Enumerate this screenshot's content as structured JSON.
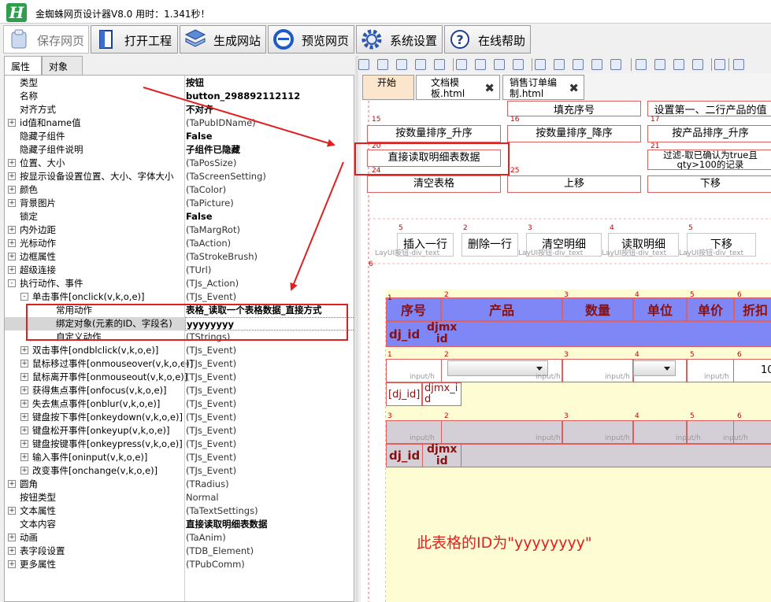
{
  "app": {
    "title": "金蜘蛛网页设计器V8.0 用时：1.341秒！",
    "logo_letter": "H"
  },
  "toolbar": [
    {
      "label": "保存网页",
      "icon": "save-page-icon",
      "pressed": true
    },
    {
      "label": "打开工程",
      "icon": "open-project-icon",
      "pressed": false
    },
    {
      "label": "生成网站",
      "icon": "generate-site-icon",
      "pressed": false
    },
    {
      "label": "预览网页",
      "icon": "preview-ie-icon",
      "pressed": false
    },
    {
      "label": "系统设置",
      "icon": "settings-gear-icon",
      "pressed": false
    },
    {
      "label": "在线帮助",
      "icon": "help-icon",
      "pressed": false
    }
  ],
  "panel_tabs": [
    "属性",
    "对象"
  ],
  "props": [
    {
      "name": "类型",
      "value": "按钮",
      "bold": true,
      "level": 0,
      "exp": ""
    },
    {
      "name": "名称",
      "value": "button_298892112112",
      "bold": true,
      "level": 0,
      "exp": ""
    },
    {
      "name": "对齐方式",
      "value": "不对齐",
      "bold": true,
      "level": 0,
      "exp": ""
    },
    {
      "name": "id值和name值",
      "value": "(TaPubIDName)",
      "bold": false,
      "level": 0,
      "exp": "+"
    },
    {
      "name": "隐藏子组件",
      "value": "False",
      "bold": true,
      "level": 0,
      "exp": ""
    },
    {
      "name": "隐藏子组件说明",
      "value": "子组件已隐藏",
      "bold": true,
      "level": 0,
      "exp": ""
    },
    {
      "name": "位置、大小",
      "value": "(TaPosSize)",
      "bold": false,
      "level": 0,
      "exp": "+"
    },
    {
      "name": "按显示设备设置位置、大小、字体大小",
      "value": "(TaScreenSetting)",
      "bold": false,
      "level": 0,
      "exp": "+"
    },
    {
      "name": "颜色",
      "value": "(TaColor)",
      "bold": false,
      "level": 0,
      "exp": "+"
    },
    {
      "name": "背景图片",
      "value": "(TaPicture)",
      "bold": false,
      "level": 0,
      "exp": "+"
    },
    {
      "name": "锁定",
      "value": "False",
      "bold": true,
      "level": 0,
      "exp": ""
    },
    {
      "name": "内外边距",
      "value": "(TaMargRot)",
      "bold": false,
      "level": 0,
      "exp": "+"
    },
    {
      "name": "光标动作",
      "value": "(TaAction)",
      "bold": false,
      "level": 0,
      "exp": "+"
    },
    {
      "name": "边框属性",
      "value": "(TaStrokeBrush)",
      "bold": false,
      "level": 0,
      "exp": "+"
    },
    {
      "name": "超级连接",
      "value": "(TUrl)",
      "bold": false,
      "level": 0,
      "exp": "+"
    },
    {
      "name": "执行动作、事件",
      "value": "(TJs_Action)",
      "bold": false,
      "level": 0,
      "exp": "-"
    },
    {
      "name": "单击事件[onclick(v,k,o,e)]",
      "value": "(TJs_Event)",
      "bold": false,
      "level": 1,
      "exp": "-"
    },
    {
      "name": "常用动作",
      "value": "表格_读取一个表格数据_直接方式",
      "bold": true,
      "level": 2,
      "exp": ""
    },
    {
      "name": "绑定对象(元素的ID、字段名)",
      "value": "yyyyyyyy",
      "bold": true,
      "level": 2,
      "exp": "",
      "selected": true
    },
    {
      "name": "自定义动作",
      "value": "(TStrings)",
      "bold": false,
      "level": 2,
      "exp": ""
    },
    {
      "name": "双击事件[ondblclick(v,k,o,e)]",
      "value": "(TJs_Event)",
      "bold": false,
      "level": 1,
      "exp": "+"
    },
    {
      "name": "鼠标移过事件[onmouseover(v,k,o,e)]",
      "value": "(TJs_Event)",
      "bold": false,
      "level": 1,
      "exp": "+"
    },
    {
      "name": "鼠标离开事件[onmouseout(v,k,o,e)]",
      "value": "(TJs_Event)",
      "bold": false,
      "level": 1,
      "exp": "+"
    },
    {
      "name": "获得焦点事件[onfocus(v,k,o,e)]",
      "value": "(TJs_Event)",
      "bold": false,
      "level": 1,
      "exp": "+"
    },
    {
      "name": "失去焦点事件[onblur(v,k,o,e)]",
      "value": "(TJs_Event)",
      "bold": false,
      "level": 1,
      "exp": "+"
    },
    {
      "name": "键盘按下事件[onkeydown(v,k,o,e)]",
      "value": "(TJs_Event)",
      "bold": false,
      "level": 1,
      "exp": "+"
    },
    {
      "name": "键盘松开事件[onkeyup(v,k,o,e)]",
      "value": "(TJs_Event)",
      "bold": false,
      "level": 1,
      "exp": "+"
    },
    {
      "name": "键盘按键事件[onkeypress(v,k,o,e)]",
      "value": "(TJs_Event)",
      "bold": false,
      "level": 1,
      "exp": "+"
    },
    {
      "name": "输入事件[oninput(v,k,o,e)]",
      "value": "(TJs_Event)",
      "bold": false,
      "level": 1,
      "exp": "+"
    },
    {
      "name": "改变事件[onchange(v,k,o,e)]",
      "value": "(TJs_Event)",
      "bold": false,
      "level": 1,
      "exp": "+"
    },
    {
      "name": "圆角",
      "value": "(TRadius)",
      "bold": false,
      "level": 0,
      "exp": "+"
    },
    {
      "name": "按钮类型",
      "value": "Normal",
      "bold": false,
      "level": 0,
      "exp": ""
    },
    {
      "name": "文本属性",
      "value": "(TaTextSettings)",
      "bold": false,
      "level": 0,
      "exp": "+"
    },
    {
      "name": "文本内容",
      "value": "直接读取明细表数据",
      "bold": true,
      "level": 0,
      "exp": ""
    },
    {
      "name": "动画",
      "value": "(TaAnim)",
      "bold": false,
      "level": 0,
      "exp": "+"
    },
    {
      "name": "表字段设置",
      "value": "(TDB_Element)",
      "bold": false,
      "level": 0,
      "exp": "+"
    },
    {
      "name": "更多属性",
      "value": "(TPubComm)",
      "bold": false,
      "level": 0,
      "exp": "+"
    }
  ],
  "doc_tabs": [
    {
      "label": "开始",
      "closable": false
    },
    {
      "label": "文档模\n板.html",
      "closable": true
    },
    {
      "label": "销售订单编\n制.html",
      "closable": true
    }
  ],
  "canvas": {
    "top_buttons": [
      "填充序号",
      "设置第一、二行产品的值",
      "按数量排序_升序",
      "按数量排序_降序",
      "按产品排序_升序",
      "直接读取明细表数据",
      "过滤-取已确认为true且\nqty>100的记录",
      "清空表格",
      "上移",
      "下移"
    ],
    "row_numbers": [
      "15",
      "16",
      "17",
      "20",
      "21",
      "24",
      "25",
      "5",
      "2",
      "3",
      "4",
      "5",
      "6"
    ],
    "layui_buttons": [
      "插入一行",
      "删除一行",
      "清空明细",
      "读取明细",
      "下移"
    ],
    "layui_label": "LayUI按钮-div_text",
    "table_headers": [
      "序号",
      "产品",
      "数量",
      "单位",
      "单价",
      "折扣"
    ],
    "header_nums": [
      "1",
      "2",
      "3",
      "4",
      "5",
      "6"
    ],
    "field_dj_id": "dj_id",
    "field_djmx_id": "djmx\nid",
    "field_dj_id_br": "[dj_id]",
    "field_djmx_i": "djmx_i\nd",
    "input_hint": "input/h",
    "value_10": "10",
    "annotation": "此表格的ID为\"yyyyyyyy\""
  }
}
